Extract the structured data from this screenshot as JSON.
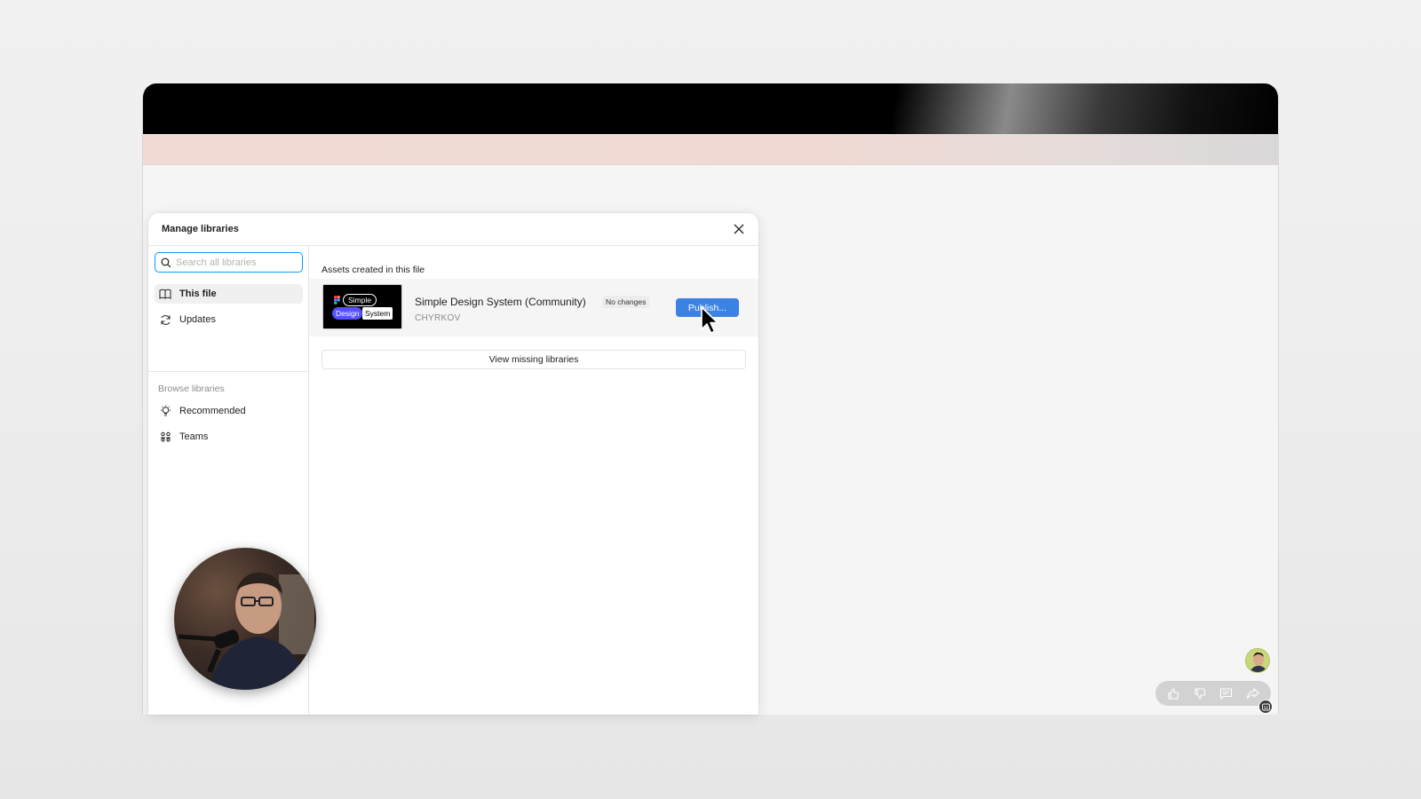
{
  "dialog": {
    "title": "Manage libraries",
    "close_icon": "close-icon"
  },
  "sidebar": {
    "search_placeholder": "Search all libraries",
    "items": [
      {
        "label": "This file",
        "icon": "book-icon",
        "active": true
      },
      {
        "label": "Updates",
        "icon": "refresh-icon",
        "active": false
      }
    ],
    "browse_label": "Browse libraries",
    "browse_items": [
      {
        "label": "Recommended",
        "icon": "lightbulb-icon"
      },
      {
        "label": "Teams",
        "icon": "team-icon"
      }
    ]
  },
  "content": {
    "heading": "Assets created in this file",
    "library": {
      "name": "Simple Design System (Community)",
      "status": "No changes",
      "author": "CHYRKOV",
      "thumbnail_words": [
        "Simple",
        "Design",
        "System"
      ],
      "publish_label": "Publish..."
    },
    "view_missing_label": "View missing libraries"
  },
  "colors": {
    "accent": "#3b82e2",
    "search_focus": "#0d99ff",
    "thumbnail_pill": "#5551ff"
  },
  "floating_actions": [
    "like-icon",
    "dislike-icon",
    "comment-icon",
    "share-icon"
  ]
}
